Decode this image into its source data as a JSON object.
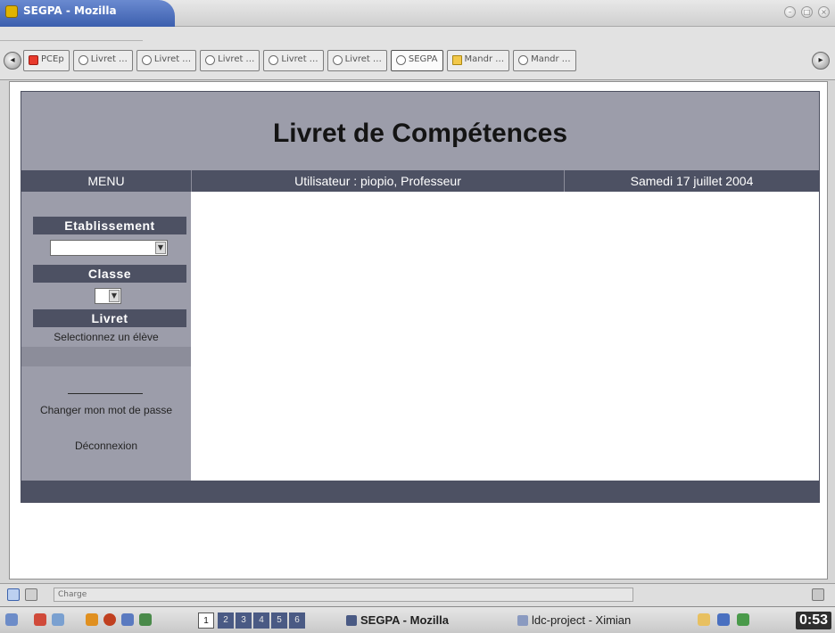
{
  "window": {
    "title": "SEGPA - Mozilla",
    "buttons": [
      "minimize-icon",
      "maximize-icon",
      "close-icon"
    ]
  },
  "browser_tabs": [
    {
      "label": "PCEp",
      "icon": "pcp-favicon"
    },
    {
      "label": "Livret",
      "icon": "globe-icon"
    },
    {
      "label": "Livret",
      "icon": "globe-icon"
    },
    {
      "label": "Livret",
      "icon": "globe-icon"
    },
    {
      "label": "Livret",
      "icon": "globe-icon"
    },
    {
      "label": "Livret",
      "icon": "globe-icon"
    },
    {
      "label": "SEGPA",
      "icon": "globe-icon",
      "active": true
    },
    {
      "label": "Mandr",
      "icon": "mandrake-icon"
    },
    {
      "label": "Mandr",
      "icon": "globe-icon"
    }
  ],
  "page": {
    "title": "Livret de Compétences",
    "header": {
      "menu": "MENU",
      "user": "Utilisateur : piopio, Professeur",
      "date": "Samedi 17 juillet 2004"
    },
    "sidebar": {
      "etablissement_title": "Etablissement",
      "etablissement_value": "",
      "classe_title": "Classe",
      "classe_value": "",
      "livret_title": "Livret",
      "livret_text": "Selectionnez un élève",
      "change_password": "Changer mon mot de passe",
      "logout": "Déconnexion"
    }
  },
  "statusbar": {
    "text": "Charge"
  },
  "taskbar": {
    "workspaces": [
      "1",
      "2",
      "3",
      "4",
      "5",
      "6"
    ],
    "active_workspace": "1",
    "tasks": [
      "SEGPA - Mozilla",
      "ldc-project - Ximian"
    ],
    "clock": "0:53"
  },
  "colors": {
    "app_bg": "#9c9daa",
    "header_bar": "#4d5163",
    "content_bg": "#ffffff",
    "title_tab": "#3c5fae"
  }
}
